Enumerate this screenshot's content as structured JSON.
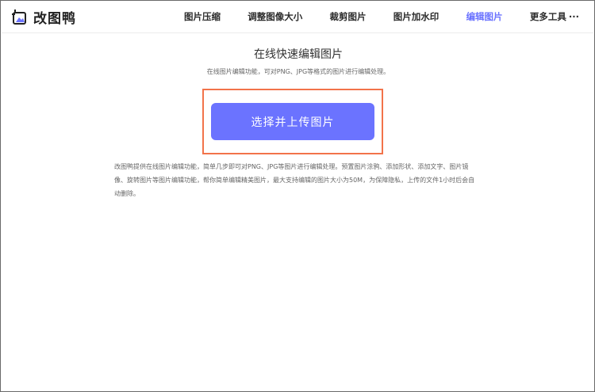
{
  "header": {
    "logo_text": "改图鸭",
    "nav": [
      {
        "label": "图片压缩"
      },
      {
        "label": "调整图像大小"
      },
      {
        "label": "裁剪图片"
      },
      {
        "label": "图片加水印"
      },
      {
        "label": "编辑图片",
        "active": true
      },
      {
        "label": "更多工具"
      }
    ],
    "more_dots": "···"
  },
  "main": {
    "title": "在线快速编辑图片",
    "subtitle": "在线图片编辑功能，可对PNG、JPG等格式的图片进行编辑处理。",
    "upload_button": "选择并上传图片",
    "description": "改图鸭提供在线图片编辑功能，简单几步即可对PNG、JPG等图片进行编辑处理。预置图片涂鸦、添加形状、添加文字、图片镜像、旋转图片等图片编辑功能，帮你简单编辑精美图片，最大支持编辑的图片大小为50M，为保障隐私，上传的文件1小时后会自动删除。"
  },
  "colors": {
    "accent": "#6b73ff",
    "highlight_border": "#f2734a"
  }
}
